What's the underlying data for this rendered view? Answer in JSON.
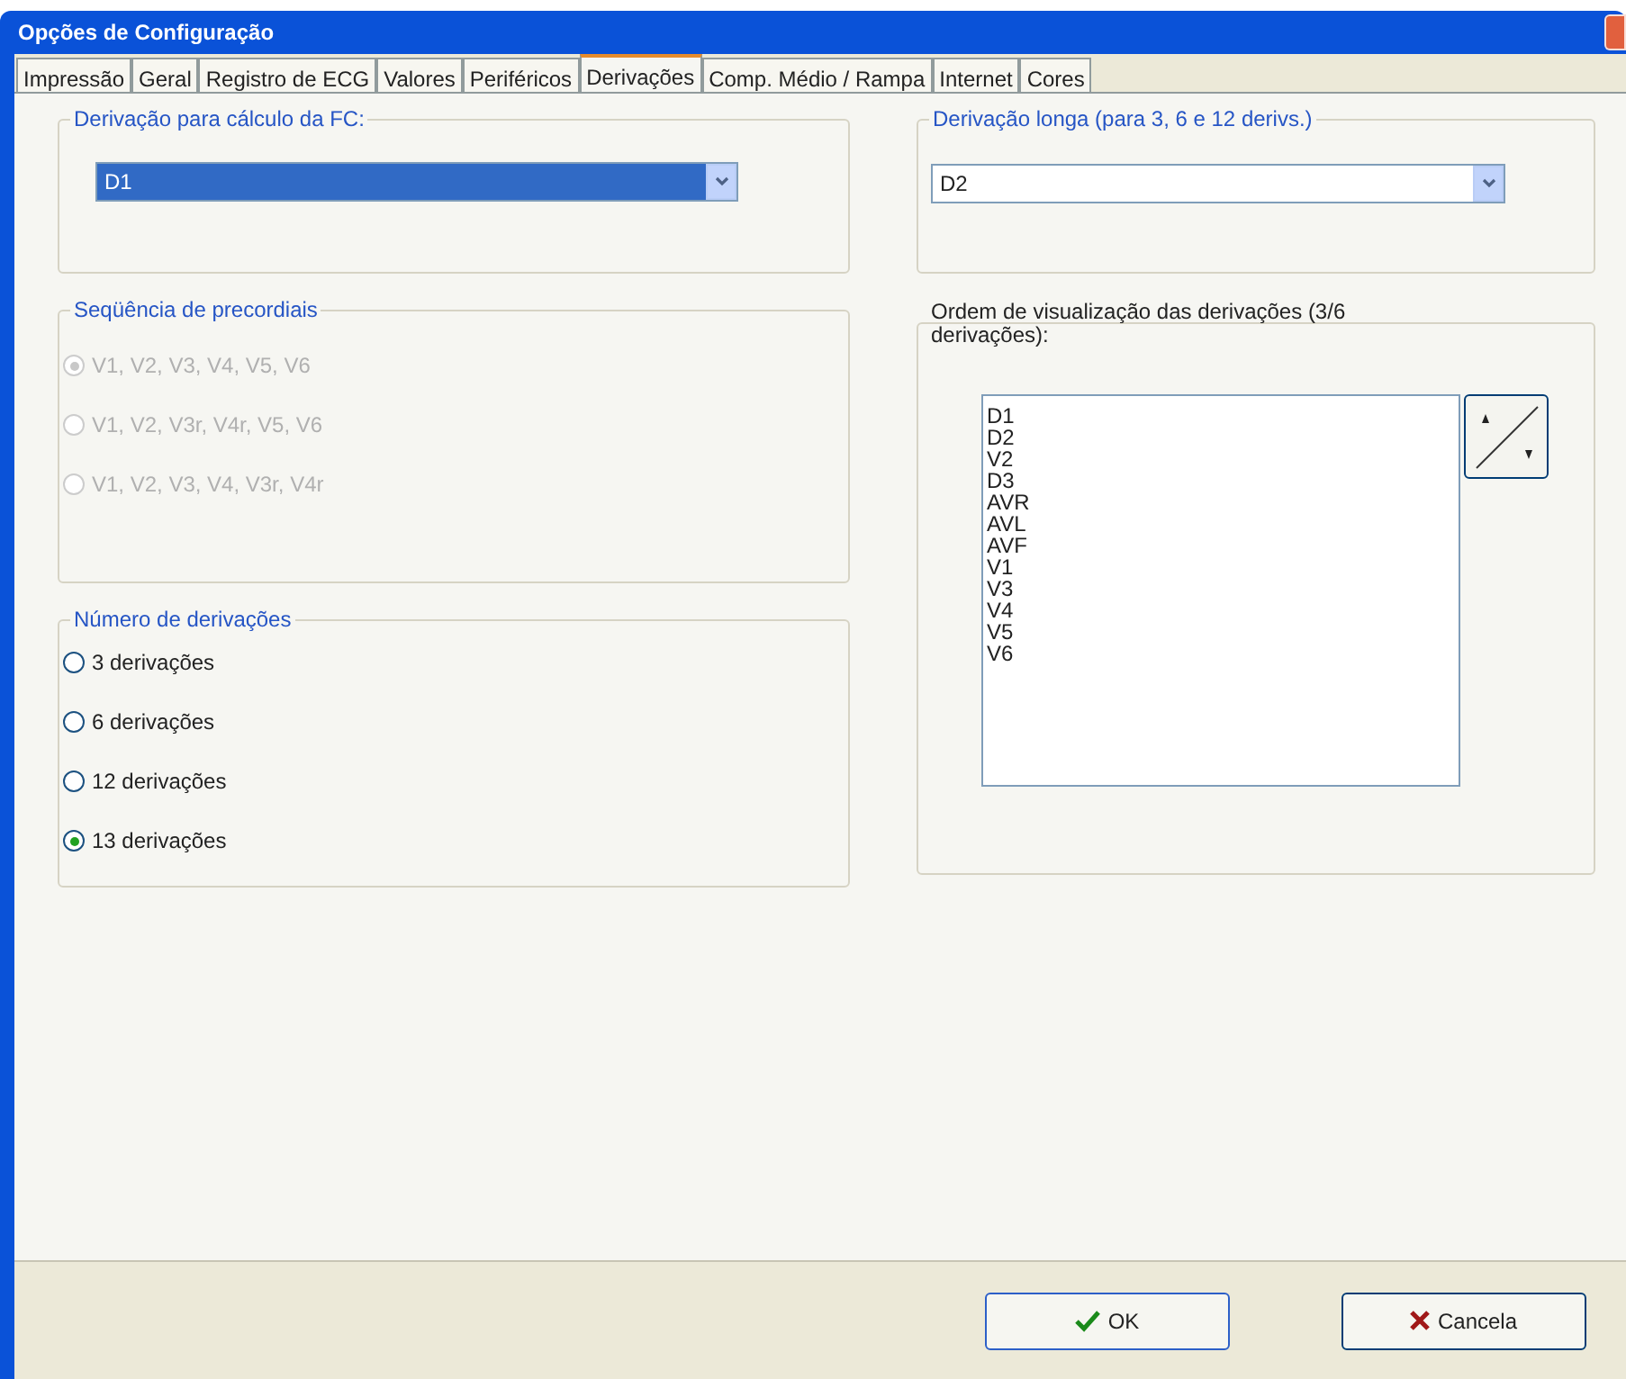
{
  "window": {
    "title": "Opções de Configuração"
  },
  "tabs": [
    {
      "label": "Impressão",
      "selected": false
    },
    {
      "label": "Geral",
      "selected": false
    },
    {
      "label": "Registro de ECG",
      "selected": false
    },
    {
      "label": "Valores",
      "selected": false
    },
    {
      "label": "Periféricos",
      "selected": false
    },
    {
      "label": "Derivações",
      "selected": true
    },
    {
      "label": "Comp. Médio / Rampa",
      "selected": false
    },
    {
      "label": "Internet",
      "selected": false
    },
    {
      "label": "Cores",
      "selected": false
    }
  ],
  "fc_group": {
    "title": "Derivação para cálculo da FC:",
    "value": "D1",
    "focused": true
  },
  "precordial_group": {
    "title": "Seqüência de precordiais",
    "disabled": true,
    "options": [
      {
        "label": "V1, V2, V3, V4, V5, V6",
        "selected": true
      },
      {
        "label": "V1, V2, V3r, V4r, V5, V6",
        "selected": false
      },
      {
        "label": "V1, V2, V3, V4, V3r, V4r",
        "selected": false
      }
    ]
  },
  "count_group": {
    "title": "Número de derivações",
    "disabled": false,
    "options": [
      {
        "label": "3 derivações",
        "selected": false
      },
      {
        "label": "6 derivações",
        "selected": false
      },
      {
        "label": "12 derivações",
        "selected": false
      },
      {
        "label": "13 derivações",
        "selected": true
      }
    ]
  },
  "long_group": {
    "title": "Derivação longa (para 3, 6 e 12 derivs.)",
    "value": "D2",
    "focused": false
  },
  "order_group": {
    "title": "Ordem de visualização das derivações (3/6 derivações):",
    "items": [
      "D1",
      "D2",
      "V2",
      "D3",
      "AVR",
      "AVL",
      "AVF",
      "V1",
      "V3",
      "V4",
      "V5",
      "V6"
    ]
  },
  "buttons": [
    {
      "kind": "ok",
      "label": "OK"
    },
    {
      "kind": "cancel",
      "label": "Cancela"
    }
  ]
}
